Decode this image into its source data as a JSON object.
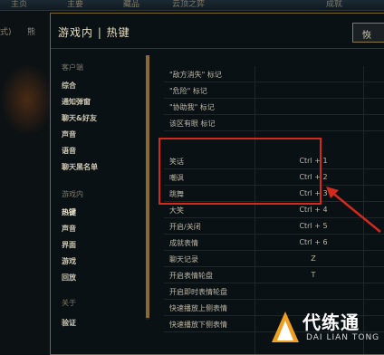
{
  "modal": {
    "title": "游戏内 | 热键",
    "top_button": "恢"
  },
  "sidebar": {
    "section_client": "客户端",
    "client_items": [
      "综合",
      "通知弹窗",
      "聊天&好友",
      "声音",
      "语音",
      "聊天黑名单"
    ],
    "section_ingame": "游戏内",
    "ingame_items": [
      "热键",
      "声音",
      "界面",
      "游戏",
      "回放"
    ],
    "section_about": "关于",
    "about_items": [
      "验证"
    ]
  },
  "hotkeys": [
    {
      "label": "\"敌方消失\" 标记",
      "key": ""
    },
    {
      "label": "\"危险\" 标记",
      "key": ""
    },
    {
      "label": "\"协助我\" 标记",
      "key": ""
    },
    {
      "label": "该区有眼 标记",
      "key": ""
    },
    {
      "label": "笑话",
      "key": "Ctrl + 1"
    },
    {
      "label": "嘲讽",
      "key": "Ctrl + 2"
    },
    {
      "label": "跳舞",
      "key": "Ctrl + 3"
    },
    {
      "label": "大笑",
      "key": "Ctrl + 4"
    },
    {
      "label": "开启/关闭",
      "key": "Ctrl + 5"
    },
    {
      "label": "成就表情",
      "key": "Ctrl + 6"
    },
    {
      "label": "聊天记录",
      "key": "Z"
    },
    {
      "label": "开启表情轮盘",
      "key": "T"
    },
    {
      "label": "开启即时表情轮盘",
      "key": ""
    },
    {
      "label": "快速播放上侧表情",
      "key": ""
    },
    {
      "label": "快速播放下侧表情",
      "key": ""
    }
  ],
  "watermark": {
    "brand": "代练通",
    "pinyin": "DAI LIAN TONG"
  },
  "colors": {
    "accent_gold": "#8a6a2e",
    "highlight_red": "#d42a1c"
  }
}
